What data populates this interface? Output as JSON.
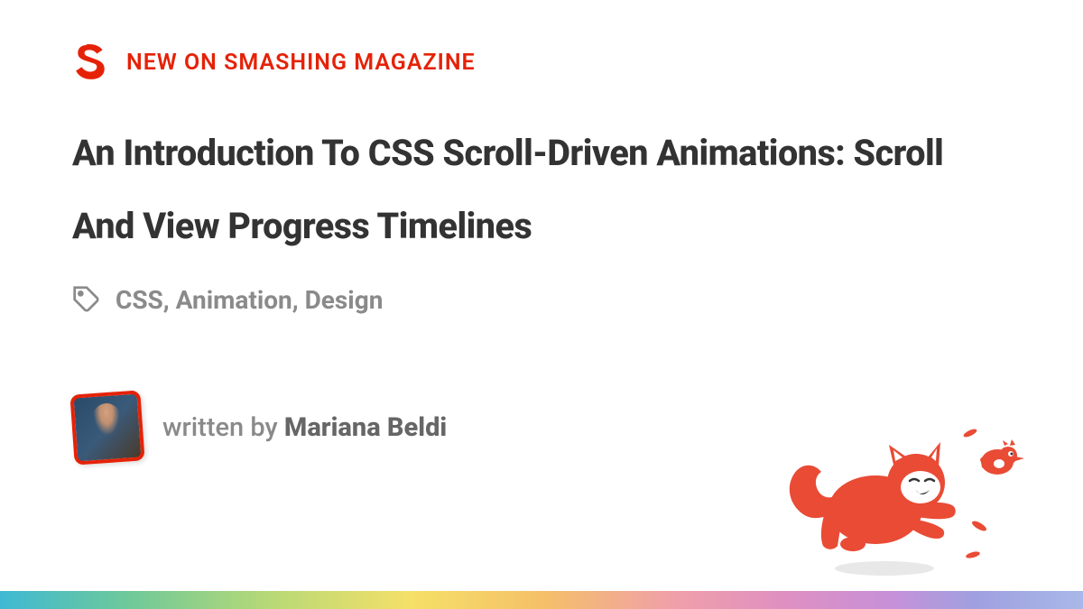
{
  "header": {
    "eyebrow": "NEW ON SMASHING MAGAZINE"
  },
  "article": {
    "title": "An Introduction To CSS Scroll-Driven Animations: Scroll And View Progress Timelines",
    "tags": "CSS, Animation, Design"
  },
  "byline": {
    "prefix": "written by ",
    "author": "Mariana Beldi"
  }
}
